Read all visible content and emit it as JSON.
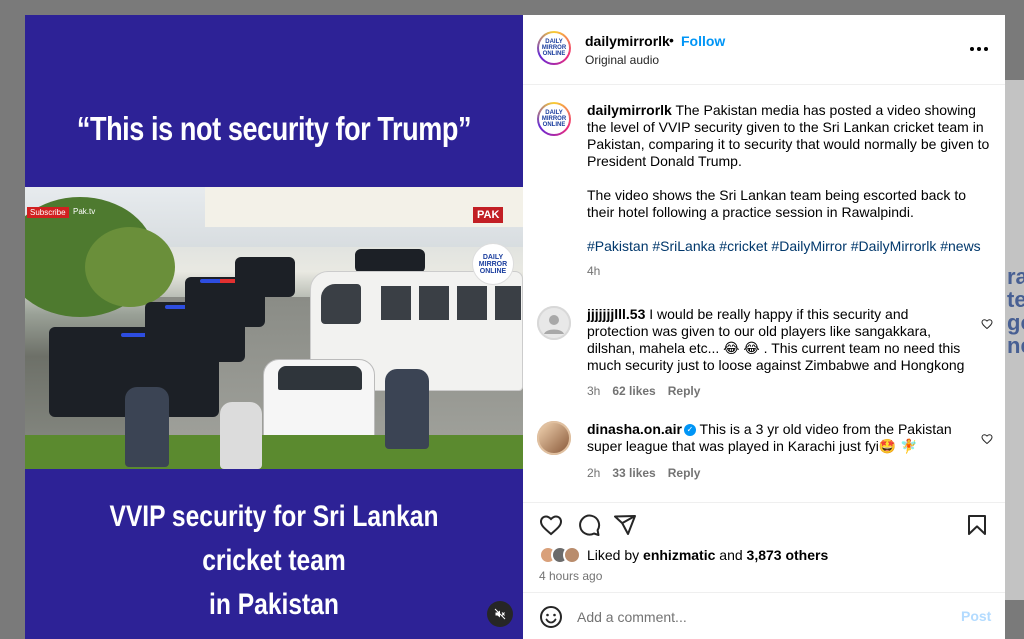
{
  "media": {
    "headline_top": "“This is not security for Trump”",
    "headline_bottom_1": "VVIP security for Sri Lankan cricket team",
    "headline_bottom_2": "in Pakistan",
    "video_subscribe": "Subscribe",
    "video_channel": "Pak.tv",
    "video_pak_badge": "PAK",
    "video_logo_text": "DAILY MIRROR ONLINE",
    "mute_icon": "speaker-muted-icon"
  },
  "header": {
    "username": "dailymirrorlk",
    "dot": "•",
    "follow_label": "Follow",
    "audio_label": "Original audio",
    "more_icon": "more-options-icon"
  },
  "caption": {
    "username": "dailymirrorlk",
    "text_1": " The Pakistan media has posted a video showing the level of VVIP security given to the Sri Lankan cricket team in Pakistan, comparing it to security that would normally be given to President Donald Trump.",
    "text_2": "The video shows the Sri Lankan team being escorted back to their hotel following a practice session in Rawalpindi.",
    "hashtags": "#Pakistan #SriLanka #cricket #DailyMirror #DailyMirrorlk #news",
    "time": "4h"
  },
  "comments": [
    {
      "username": "jjjjjjjlll.53",
      "text": " I would be really happy if this security and protection was given to our old players like sangakkara, dilshan, mahela etc... 😂 😂 . This current team no need this much security just to loose against Zimbabwe and Hongkong",
      "time": "3h",
      "likes": "62 likes",
      "reply": "Reply"
    },
    {
      "username": "dinasha.on.air",
      "verified": "✓",
      "text": " This is a 3 yr old video from the Pakistan super league that was played in Karachi just fyi🤩 🧚",
      "time": "2h",
      "likes": "33 likes",
      "reply": "Reply"
    }
  ],
  "actions": {
    "like_icon": "heart-icon",
    "comment_icon": "comment-icon",
    "share_icon": "share-icon",
    "save_icon": "bookmark-icon",
    "liked_by_prefix": "Liked by ",
    "liked_by_user": "enhizmatic",
    "liked_by_and": " and ",
    "liked_by_count": "3,873 others",
    "post_time": "4 hours ago"
  },
  "comment_box": {
    "placeholder": "Add a comment...",
    "post_label": "Post",
    "emoji_icon": "emoji-icon"
  },
  "background": {
    "text_lines": [
      "ra",
      "te",
      "go",
      "ne"
    ]
  },
  "colors": {
    "media_bg": "#2d2296",
    "link_blue": "#0095f6",
    "hashtag": "#00376b",
    "muted": "#737373"
  }
}
